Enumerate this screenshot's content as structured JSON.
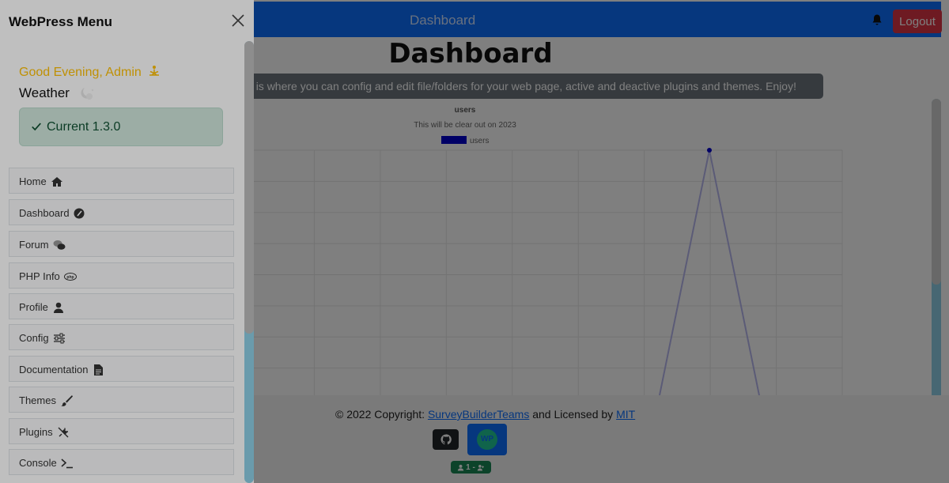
{
  "header": {
    "title": "Dashboard",
    "logout_label": "Logout"
  },
  "main": {
    "heading": "Dashboard",
    "welcome_text": "anel! This is where you can config and edit file/folders for your web page, active and deactive plugins and themes. Enjoy!"
  },
  "chart_data": {
    "type": "line",
    "title": "users",
    "subtitle": "This will be clear out on 2023",
    "legend": "top",
    "series": [
      {
        "name": "users",
        "color": "#0000cc",
        "points": [
          [
            -0.4,
            -0.5
          ],
          [
            0,
            1
          ],
          [
            0.4,
            -0.5
          ]
        ]
      }
    ],
    "grid": true,
    "line_color": "#b7b7ee"
  },
  "footer": {
    "copyright_prefix": "© 2022 Copyright: ",
    "team_link": "SurveyBuilderTeams",
    "licensed_text": " and Licensed by ",
    "license_link": "MIT",
    "wp_label": "WP",
    "user_badge": "1 -"
  },
  "menu": {
    "title": "WebPress Menu",
    "greeting": "Good Evening, Admin",
    "weather_label": "Weather",
    "version_label": "Current 1.3.0",
    "items": [
      {
        "label": "Home",
        "icon": "home-icon"
      },
      {
        "label": "Dashboard",
        "icon": "gauge-icon"
      },
      {
        "label": "Forum",
        "icon": "comments-icon"
      },
      {
        "label": "PHP Info",
        "icon": "php-icon"
      },
      {
        "label": "Profile",
        "icon": "user-icon"
      },
      {
        "label": "Config",
        "icon": "sliders-icon"
      },
      {
        "label": "Documentation",
        "icon": "file-icon"
      },
      {
        "label": "Themes",
        "icon": "brush-icon"
      },
      {
        "label": "Plugins",
        "icon": "plug-icon"
      },
      {
        "label": "Console",
        "icon": "terminal-icon"
      }
    ]
  },
  "colors": {
    "topbar": "#0d6efd",
    "logout": "#dc3545",
    "greeting": "#ffc107",
    "version_bg": "#d1e7dd",
    "user_badge": "#198754"
  }
}
